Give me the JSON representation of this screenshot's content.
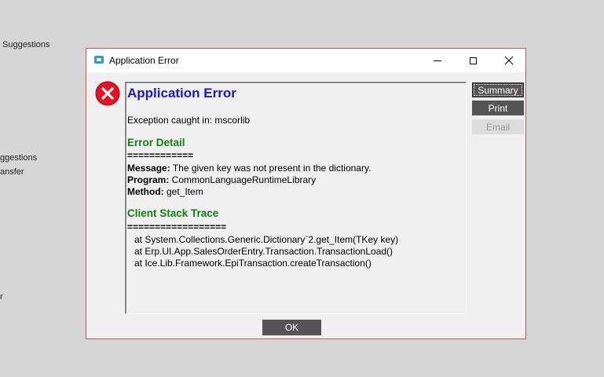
{
  "background": {
    "lines": [
      "Suggestions",
      "ggestions",
      "ansfer",
      "r"
    ]
  },
  "dialog": {
    "title": "Application Error",
    "content": {
      "heading": "Application Error",
      "exception_line": "Exception caught in: mscorlib",
      "error_detail_heading": "Error Detail",
      "error_detail_separator": "============",
      "message_label": "Message:",
      "message_value": " The given key was not present in the dictionary.",
      "program_label": "Program:",
      "program_value": " CommonLanguageRuntimeLibrary",
      "method_label": "Method:",
      "method_value": " get_Item",
      "stack_heading": "Client Stack Trace",
      "stack_separator": "==================",
      "stack_lines": [
        "at System.Collections.Generic.Dictionary`2.get_Item(TKey key)",
        "at Erp.UI.App.SalesOrderEntry.Transaction.TransactionLoad()",
        "at Ice.Lib.Framework.EpiTransaction.createTransaction()"
      ]
    },
    "buttons": {
      "summary": "Summary",
      "print": "Print",
      "email": "Email",
      "ok": "OK"
    }
  },
  "colors": {
    "heading_blue": "#1818c8",
    "section_green": "#108010",
    "dialog_border": "#d9504f",
    "error_red": "#e81123"
  }
}
